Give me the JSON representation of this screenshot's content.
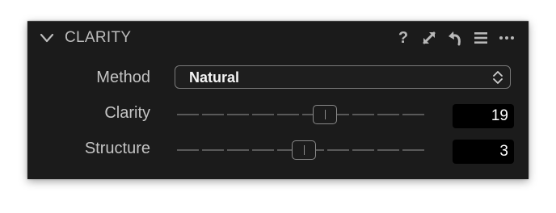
{
  "panel": {
    "title": "CLARITY",
    "header_icons": [
      "help-icon",
      "expand-icon",
      "undo-icon",
      "menu-icon",
      "more-icon"
    ],
    "help_glyph": "?",
    "colors": {
      "panel_bg": "#1b1b1b",
      "text": "#c4c4c4",
      "value_bg": "#000000"
    }
  },
  "method": {
    "label": "Method",
    "value": "Natural"
  },
  "clarity": {
    "label": "Clarity",
    "value": "19",
    "level": 0.595
  },
  "structure": {
    "label": "Structure",
    "value": "3",
    "level": 0.51
  }
}
